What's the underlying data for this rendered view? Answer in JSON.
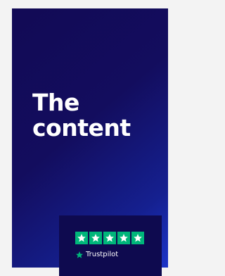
{
  "hero": {
    "headline_line1": "The",
    "headline_line2": "content"
  },
  "trustpilot": {
    "stars": 5,
    "brand": "Trustpilot",
    "star_color": "#00b67a"
  },
  "colors": {
    "card_gradient_start": "#120a55",
    "card_gradient_end": "#1c34c8",
    "badge_bg": "#0e0a4f",
    "text": "#ffffff"
  }
}
